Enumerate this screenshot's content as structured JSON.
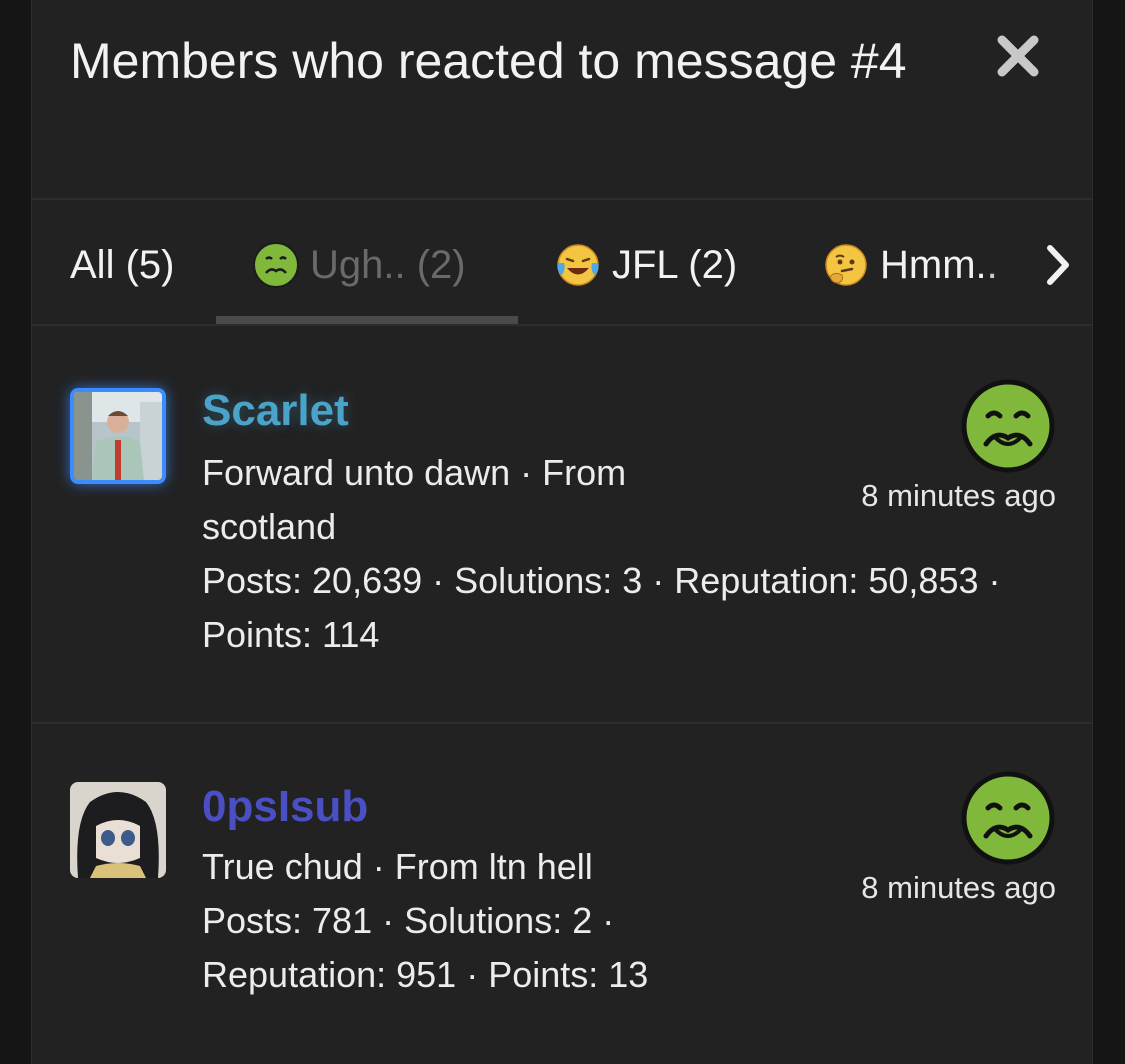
{
  "dialog": {
    "title": "Members who reacted to message #4",
    "close_icon": "close-icon"
  },
  "tabs": [
    {
      "label": "All (5)",
      "icon": null,
      "active": false
    },
    {
      "label": "Ugh.. (2)",
      "icon": "nauseated-face-icon",
      "active": true
    },
    {
      "label": "JFL (2)",
      "icon": "tears-of-joy-face-icon",
      "active": false
    },
    {
      "label": "Hmm..",
      "icon": "thinking-face-icon",
      "active": false
    }
  ],
  "members": [
    {
      "username": "Scarlet",
      "username_color": "#4aa3c8",
      "custom_title": "Forward unto dawn · From scotland",
      "stats": "Posts: 20,639 · Solutions: 3 · Reputation: 50,853 · Points: 114",
      "reaction": "nauseated-face-icon",
      "time": "8 minutes ago"
    },
    {
      "username": "0psIsub",
      "username_color": "#4a4fc4",
      "custom_title": "True chud · From ltn hell",
      "stats": "Posts: 781 · Solutions: 2 · Reputation: 951 · Points: 13",
      "reaction": "nauseated-face-icon",
      "time": "8 minutes ago"
    }
  ],
  "colors": {
    "background": "#222223",
    "text": "#f2f2f2",
    "avatar_highlight": "#3d8cff"
  }
}
